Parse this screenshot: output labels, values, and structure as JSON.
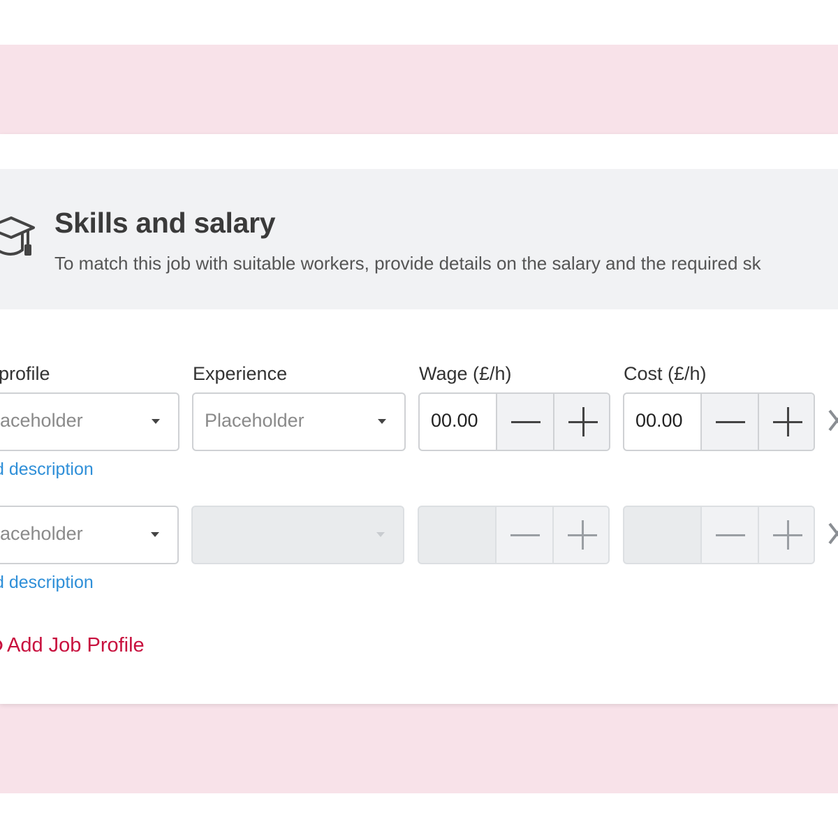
{
  "section": {
    "title": "Skills and salary",
    "subtitle": "To match this job with suitable workers, provide details on the salary and the required sk"
  },
  "columns": {
    "profile": "profile",
    "experience": "Experience",
    "wage": "Wage (£/h)",
    "cost": "Cost (£/h)"
  },
  "rows": [
    {
      "profile_placeholder": "aceholder",
      "experience_placeholder": "Placeholder",
      "wage_value": "00.00",
      "cost_value": "00.00",
      "description_link": "d description"
    },
    {
      "profile_placeholder": "aceholder",
      "description_link": "d description"
    }
  ],
  "actions": {
    "add_job_profile": "Add Job Profile"
  },
  "colors": {
    "band": "#f8e2e9",
    "header_bg": "#f1f2f4",
    "link": "#2f8fd8",
    "accent": "#c8103e"
  },
  "icons": {
    "section": "graduation-cap-icon",
    "dropdown": "caret-down-icon",
    "decrement": "minus-icon",
    "increment": "plus-icon",
    "remove": "close-icon"
  }
}
